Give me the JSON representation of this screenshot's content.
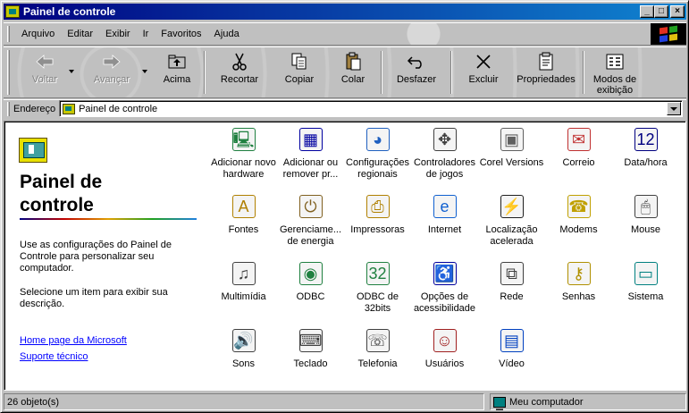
{
  "window": {
    "title": "Painel de controle"
  },
  "title_buttons": {
    "minimize": "_",
    "maximize": "□",
    "close": "×"
  },
  "menu": {
    "items": [
      "Arquivo",
      "Editar",
      "Exibir",
      "Ir",
      "Favoritos",
      "Ajuda"
    ]
  },
  "toolbar": {
    "back": "Voltar",
    "forward": "Avançar",
    "up": "Acima",
    "cut": "Recortar",
    "copy": "Copiar",
    "paste": "Colar",
    "undo": "Desfazer",
    "delete": "Excluir",
    "properties": "Propriedades",
    "views": "Modos de exibição"
  },
  "address": {
    "label": "Endereço",
    "value": "Painel de controle"
  },
  "left_pane": {
    "title": "Painel de controle",
    "description_1": "Use as configurações do Painel de Controle para personalizar seu computador.",
    "description_2": "Selecione um item para exibir sua descrição.",
    "link_1": "Home page da Microsoft",
    "link_2": "Suporte técnico"
  },
  "items": [
    {
      "label": "Adicionar novo hardware",
      "icon": "hardware-icon",
      "glyph": "🖳",
      "color": "#208040"
    },
    {
      "label": "Adicionar ou remover pr...",
      "icon": "add-remove-programs-icon",
      "glyph": "▦",
      "color": "#0000a0"
    },
    {
      "label": "Configurações regionais",
      "icon": "globe-icon",
      "glyph": "◕",
      "color": "#2060c0"
    },
    {
      "label": "Controladores de jogos",
      "icon": "joystick-icon",
      "glyph": "✥",
      "color": "#404040"
    },
    {
      "label": "Corel Versions",
      "icon": "corel-versions-icon",
      "glyph": "▣",
      "color": "#606060"
    },
    {
      "label": "Correio",
      "icon": "mail-icon",
      "glyph": "✉",
      "color": "#c03030"
    },
    {
      "label": "Data/hora",
      "icon": "calendar-clock-icon",
      "glyph": "12",
      "color": "#000080"
    },
    {
      "label": "Fontes",
      "icon": "fonts-folder-icon",
      "glyph": "A",
      "color": "#b08000"
    },
    {
      "label": "Gerenciame... de energia",
      "icon": "power-plug-icon",
      "glyph": "⏻",
      "color": "#806020"
    },
    {
      "label": "Impressoras",
      "icon": "printers-folder-icon",
      "glyph": "⎙",
      "color": "#b08000"
    },
    {
      "label": "Internet",
      "icon": "internet-explorer-icon",
      "glyph": "e",
      "color": "#1060d0"
    },
    {
      "label": "Localização acelerada",
      "icon": "binoculars-icon",
      "glyph": "⚡",
      "color": "#202020"
    },
    {
      "label": "Modems",
      "icon": "modem-phone-icon",
      "glyph": "☎",
      "color": "#c0a000"
    },
    {
      "label": "Mouse",
      "icon": "mouse-icon",
      "glyph": "🖱",
      "color": "#404040"
    },
    {
      "label": "Multimídia",
      "icon": "multimedia-icon",
      "glyph": "♫",
      "color": "#404040"
    },
    {
      "label": "ODBC",
      "icon": "odbc-icon",
      "glyph": "◉",
      "color": "#208040"
    },
    {
      "label": "ODBC de 32bits",
      "icon": "odbc-32-icon",
      "glyph": "32",
      "color": "#208040"
    },
    {
      "label": "Opções de acessibilidade",
      "icon": "accessibility-icon",
      "glyph": "♿",
      "color": "#0000a0"
    },
    {
      "label": "Rede",
      "icon": "network-icon",
      "glyph": "⧉",
      "color": "#404040"
    },
    {
      "label": "Senhas",
      "icon": "keys-icon",
      "glyph": "⚷",
      "color": "#b09000"
    },
    {
      "label": "Sistema",
      "icon": "system-computer-icon",
      "glyph": "▭",
      "color": "#008080"
    },
    {
      "label": "Sons",
      "icon": "speaker-icon",
      "glyph": "🔊",
      "color": "#404040"
    },
    {
      "label": "Teclado",
      "icon": "keyboard-icon",
      "glyph": "⌨",
      "color": "#404040"
    },
    {
      "label": "Telefonia",
      "icon": "telephony-icon",
      "glyph": "☏",
      "color": "#404040"
    },
    {
      "label": "Usuários",
      "icon": "users-icon",
      "glyph": "☺",
      "color": "#a02020"
    },
    {
      "label": "Vídeo",
      "icon": "display-icon",
      "glyph": "▤",
      "color": "#0040c0"
    }
  ],
  "status": {
    "count": "26 objeto(s)",
    "location": "Meu computador"
  }
}
